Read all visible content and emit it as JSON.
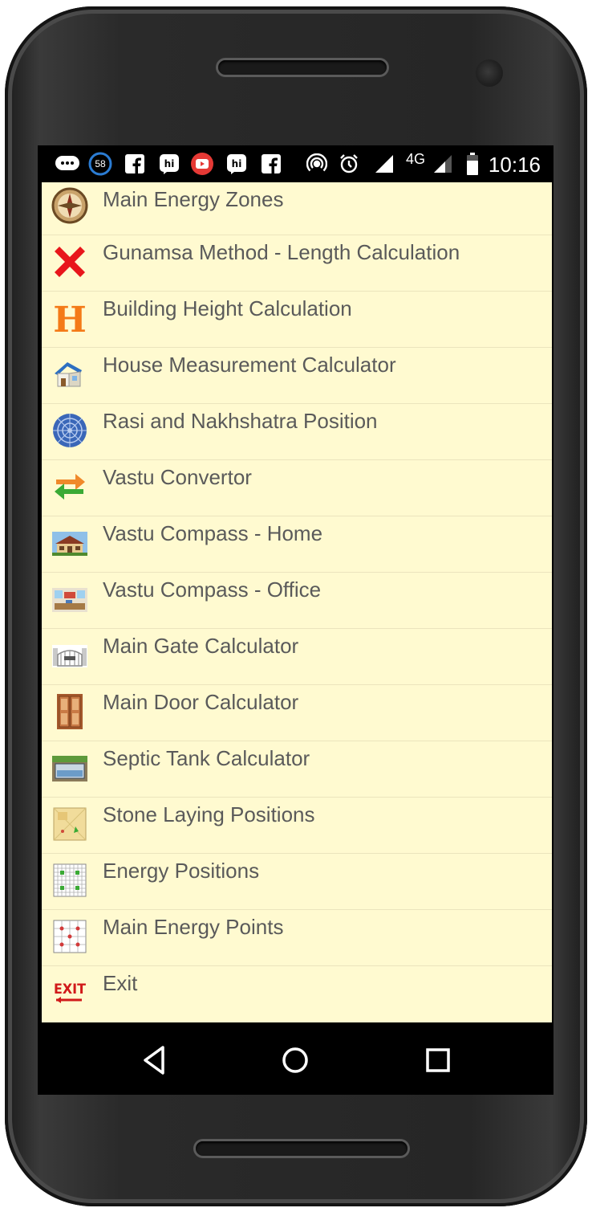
{
  "status_bar": {
    "notification_count": "58",
    "network": "4G",
    "time": "10:16",
    "icons": [
      "message-icon",
      "notification-count-icon",
      "facebook-icon",
      "hike-icon",
      "youtube-icon",
      "hike-icon",
      "facebook-icon",
      "hotspot-icon",
      "alarm-icon",
      "signal-icon",
      "signal-icon",
      "battery-icon"
    ]
  },
  "menu": {
    "items": [
      {
        "label": "Main Energy Zones",
        "icon": "compass-icon"
      },
      {
        "label": "Gunamsa Method - Length Calculation",
        "icon": "red-cross-icon"
      },
      {
        "label": "Building Height Calculation",
        "icon": "letter-h-icon"
      },
      {
        "label": "House Measurement Calculator",
        "icon": "house-icon"
      },
      {
        "label": "Rasi and Nakhshatra Position",
        "icon": "zodiac-wheel-icon"
      },
      {
        "label": "Vastu Convertor",
        "icon": "convert-arrows-icon"
      },
      {
        "label": "Vastu Compass - Home",
        "icon": "home-photo-icon"
      },
      {
        "label": "Vastu Compass - Office",
        "icon": "office-photo-icon"
      },
      {
        "label": "Main Gate Calculator",
        "icon": "gate-icon"
      },
      {
        "label": "Main Door Calculator",
        "icon": "door-icon"
      },
      {
        "label": "Septic Tank Calculator",
        "icon": "septic-tank-icon"
      },
      {
        "label": "Stone Laying Positions",
        "icon": "site-plan-icon"
      },
      {
        "label": "Energy Positions",
        "icon": "grid-green-icon"
      },
      {
        "label": "Main Energy Points",
        "icon": "grid-red-icon"
      },
      {
        "label": "Exit",
        "icon": "exit-sign-icon"
      }
    ]
  },
  "nav_bar": {
    "buttons": [
      "back-icon",
      "home-icon",
      "recents-icon"
    ]
  },
  "colors": {
    "list_background": "#fffad0",
    "divider": "#ebe4bd",
    "text": "#5a5a5a"
  }
}
